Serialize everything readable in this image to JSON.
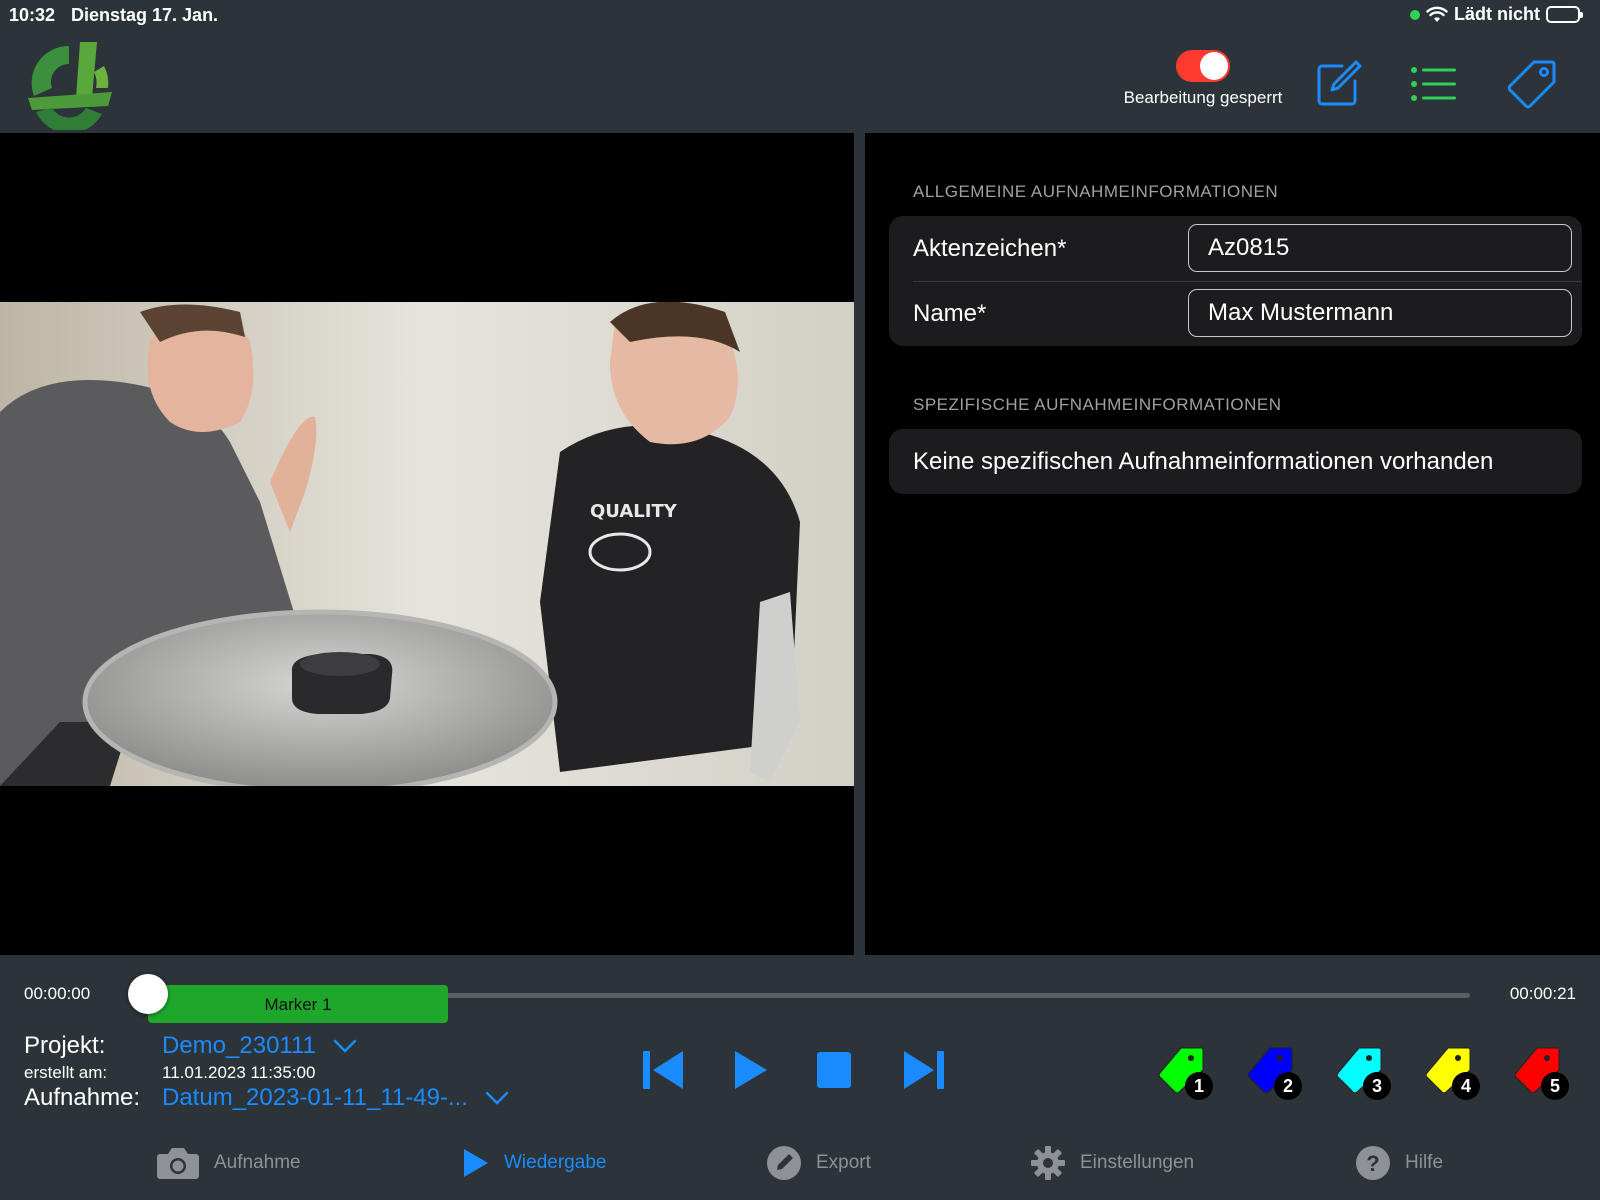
{
  "status_bar": {
    "time": "10:32",
    "date": "Dienstag 17. Jan.",
    "charging": "Lädt nicht"
  },
  "toolbar": {
    "toggle_label": "Bearbeitung gesperrt",
    "toggle_on": true,
    "toggle_color": "#ff3b30",
    "icons": [
      "edit-icon",
      "list-icon",
      "tag-icon"
    ],
    "accent": "#1a8cff",
    "list_color": "#2fd158"
  },
  "info_panel": {
    "general_title": "ALLGEMEINE AUFNAHMEINFORMATIONEN",
    "fields": [
      {
        "label": "Aktenzeichen*",
        "value": "Az0815"
      },
      {
        "label": "Name*",
        "value": "Max Mustermann"
      }
    ],
    "specific_title": "SPEZIFISCHE AUFNAHMEINFORMATIONEN",
    "specific_empty": "Keine spezifischen Aufnahmeinformationen vorhanden"
  },
  "timeline": {
    "start": "00:00:00",
    "end": "00:00:21",
    "marker_label": "Marker 1",
    "marker_color": "#1ea72a"
  },
  "project": {
    "project_label": "Projekt:",
    "project_value": "Demo_230111",
    "created_label": "erstellt am:",
    "created_value": "11.01.2023 11:35:00",
    "recording_label": "Aufnahme:",
    "recording_value": "Datum_2023-01-11_11-49-..."
  },
  "playback": {
    "controls": [
      "skip-back-icon",
      "play-icon",
      "stop-icon",
      "skip-forward-icon"
    ]
  },
  "tags": [
    {
      "num": "1",
      "color": "#00ff00"
    },
    {
      "num": "2",
      "color": "#0000ff"
    },
    {
      "num": "3",
      "color": "#00ffff"
    },
    {
      "num": "4",
      "color": "#ffff00"
    },
    {
      "num": "5",
      "color": "#ff0000"
    }
  ],
  "tabs": [
    {
      "label": "Aufnahme",
      "icon": "camera-icon",
      "active": false
    },
    {
      "label": "Wiedergabe",
      "icon": "play-icon",
      "active": true
    },
    {
      "label": "Export",
      "icon": "pencil-icon",
      "active": false
    },
    {
      "label": "Einstellungen",
      "icon": "gear-icon",
      "active": false
    },
    {
      "label": "Hilfe",
      "icon": "help-icon",
      "active": false
    }
  ]
}
